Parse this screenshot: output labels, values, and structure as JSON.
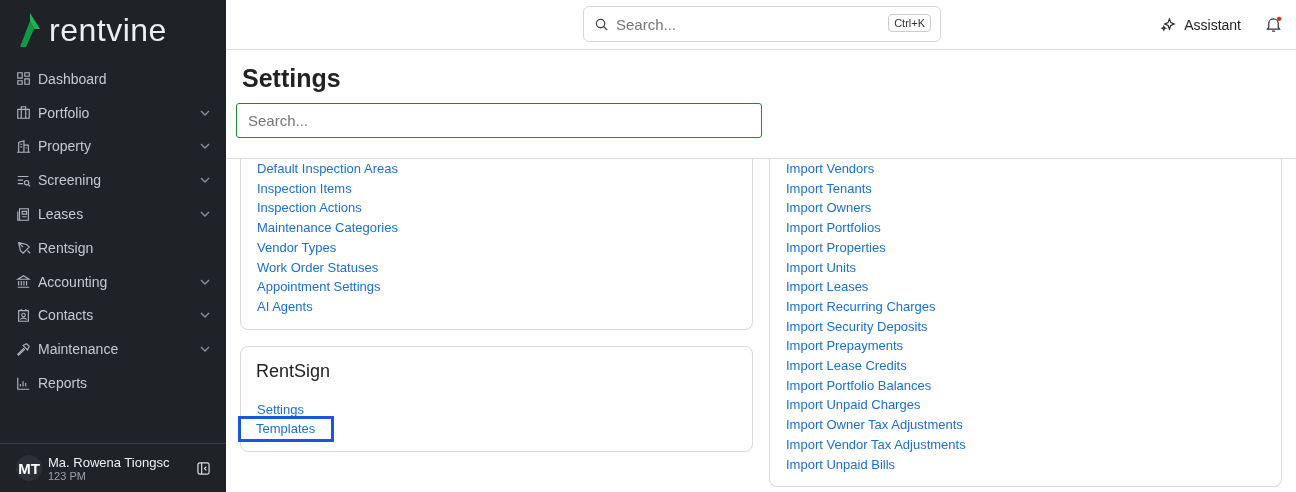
{
  "sidebar": {
    "logo": "rentvine",
    "items": [
      {
        "label": "Dashboard",
        "expandable": false
      },
      {
        "label": "Portfolio",
        "expandable": true
      },
      {
        "label": "Property",
        "expandable": true
      },
      {
        "label": "Screening",
        "expandable": true
      },
      {
        "label": "Leases",
        "expandable": true
      },
      {
        "label": "Rentsign",
        "expandable": false
      },
      {
        "label": "Accounting",
        "expandable": true
      },
      {
        "label": "Contacts",
        "expandable": true
      },
      {
        "label": "Maintenance",
        "expandable": true
      },
      {
        "label": "Reports",
        "expandable": false
      }
    ],
    "user": {
      "initials": "MT",
      "name": "Ma. Rowena Tiongsc",
      "subtitle": "123 PM"
    }
  },
  "topbar": {
    "search": {
      "placeholder": "Search...",
      "shortcut": "Ctrl+K"
    },
    "assistant": "Assistant",
    "notifications_unread": true
  },
  "page": {
    "title": "Settings",
    "search": {
      "placeholder": "Search..."
    }
  },
  "left_cards": [
    {
      "links": [
        {
          "label": "Default Inspection Areas",
          "highlighted": false
        },
        {
          "label": "Inspection Items",
          "highlighted": false
        },
        {
          "label": "Inspection Actions",
          "highlighted": false
        },
        {
          "label": "Maintenance Categories",
          "highlighted": false
        },
        {
          "label": "Vendor Types",
          "highlighted": false
        },
        {
          "label": "Work Order Statuses",
          "highlighted": false
        },
        {
          "label": "Appointment Settings",
          "highlighted": false
        },
        {
          "label": "AI Agents",
          "highlighted": false
        }
      ]
    },
    {
      "title": "RentSign",
      "links": [
        {
          "label": "Settings",
          "highlighted": false
        },
        {
          "label": "Templates",
          "highlighted": true
        }
      ]
    }
  ],
  "right_card": {
    "links": [
      {
        "label": "Import Vendors",
        "highlighted": false
      },
      {
        "label": "Import Tenants",
        "highlighted": false
      },
      {
        "label": "Import Owners",
        "highlighted": false
      },
      {
        "label": "Import Portfolios",
        "highlighted": false
      },
      {
        "label": "Import Properties",
        "highlighted": false
      },
      {
        "label": "Import Units",
        "highlighted": false
      },
      {
        "label": "Import Leases",
        "highlighted": false
      },
      {
        "label": "Import Recurring Charges",
        "highlighted": false
      },
      {
        "label": "Import Security Deposits",
        "highlighted": false
      },
      {
        "label": "Import Prepayments",
        "highlighted": false
      },
      {
        "label": "Import Lease Credits",
        "highlighted": false
      },
      {
        "label": "Import Portfolio Balances",
        "highlighted": false
      },
      {
        "label": "Import Unpaid Charges",
        "highlighted": false
      },
      {
        "label": "Import Owner Tax Adjustments",
        "highlighted": false
      },
      {
        "label": "Import Vendor Tax Adjustments",
        "highlighted": false
      },
      {
        "label": "Import Unpaid Bills",
        "highlighted": false
      }
    ]
  }
}
